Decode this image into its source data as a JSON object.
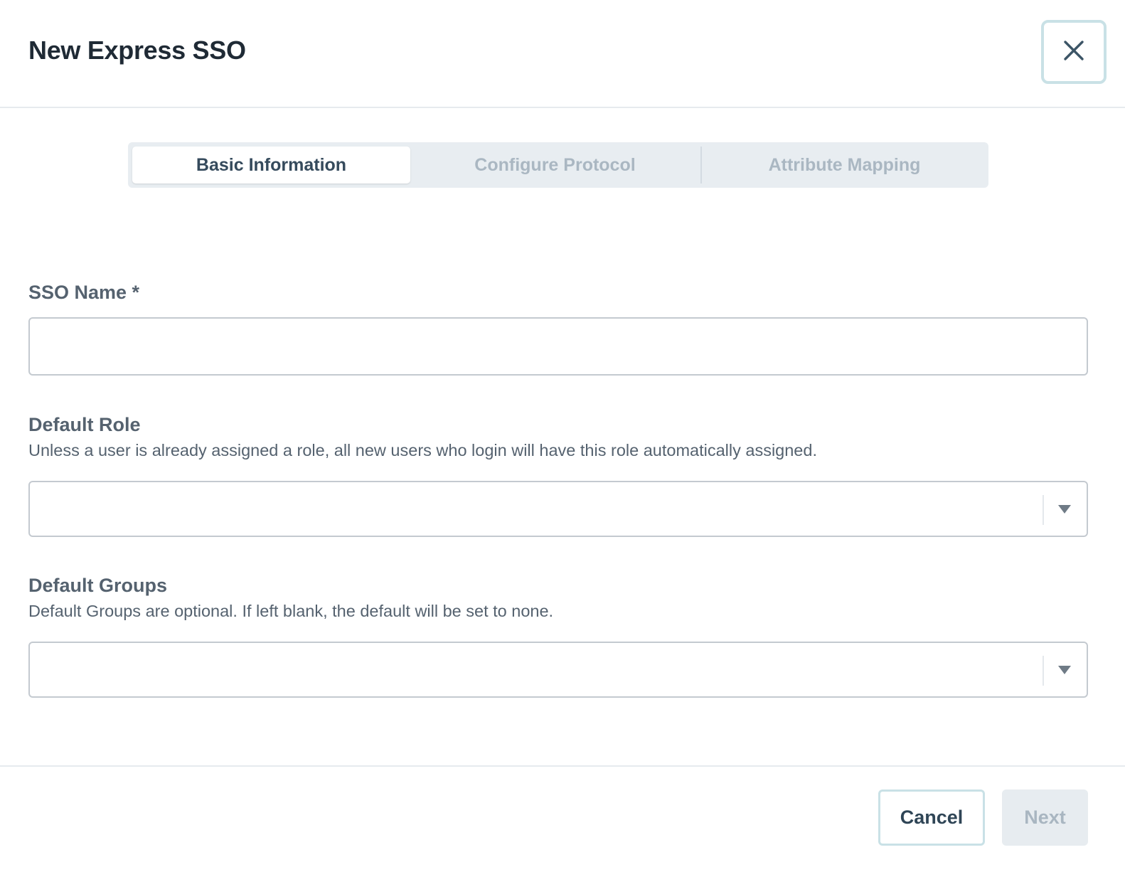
{
  "header": {
    "title": "New Express SSO",
    "close_icon": "close-icon"
  },
  "tabs": [
    {
      "label": "Basic Information",
      "active": true
    },
    {
      "label": "Configure Protocol",
      "active": false
    },
    {
      "label": "Attribute Mapping",
      "active": false
    }
  ],
  "form": {
    "sso_name": {
      "label": "SSO Name *",
      "value": ""
    },
    "default_role": {
      "label": "Default Role",
      "help": "Unless a user is already assigned a role, all new users who login will have this role automatically assigned.",
      "value": ""
    },
    "default_groups": {
      "label": "Default Groups",
      "help": "Default Groups are optional. If left blank, the default will be set to none.",
      "value": ""
    }
  },
  "footer": {
    "cancel_label": "Cancel",
    "next_label": "Next"
  },
  "colors": {
    "title": "#1f2a35",
    "tab_active_text": "#354a5c",
    "tab_inactive_text": "#aab7c2",
    "close_border": "#c9e1e6",
    "next_disabled_bg": "#e7ecf0"
  }
}
